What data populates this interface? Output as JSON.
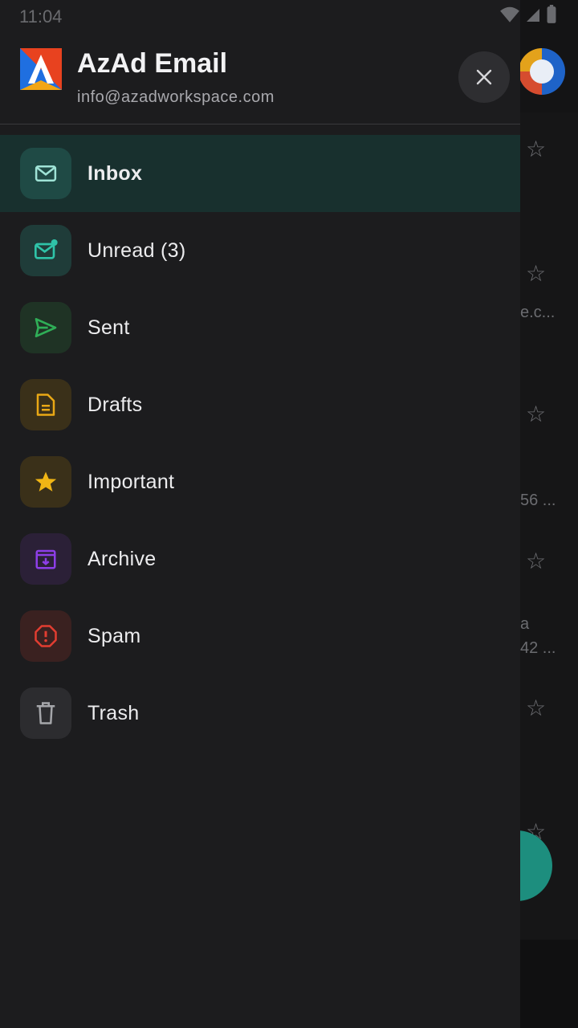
{
  "status_bar": {
    "time": "11:04"
  },
  "drawer": {
    "app_title": "AzAd Email",
    "account_email": "info@azadworkspace.com",
    "items": [
      {
        "label": "Inbox",
        "icon": "mail-icon",
        "color": "#9fe3d6",
        "bg": "#1f4a45",
        "active": true
      },
      {
        "label": "Unread (3)",
        "icon": "mail-unread-icon",
        "color": "#2fc3a8",
        "bg": "#1f3c39",
        "active": false
      },
      {
        "label": "Sent",
        "icon": "send-icon",
        "color": "#2fae57",
        "bg": "#1f3325",
        "active": false
      },
      {
        "label": "Drafts",
        "icon": "draft-icon",
        "color": "#e9a815",
        "bg": "#3a3019",
        "active": false
      },
      {
        "label": "Important",
        "icon": "star-icon",
        "color": "#f0b515",
        "bg": "#3a3019",
        "active": false
      },
      {
        "label": "Archive",
        "icon": "archive-icon",
        "color": "#8d3ee8",
        "bg": "#2b2037",
        "active": false
      },
      {
        "label": "Spam",
        "icon": "spam-icon",
        "color": "#e23d31",
        "bg": "#3a2120",
        "active": false
      },
      {
        "label": "Trash",
        "icon": "trash-icon",
        "color": "#a5a6aa",
        "bg": "#2c2c2f",
        "active": false
      }
    ]
  },
  "background": {
    "snippets": [
      "e.c...",
      "56 ...",
      "a",
      "42 ..."
    ]
  }
}
